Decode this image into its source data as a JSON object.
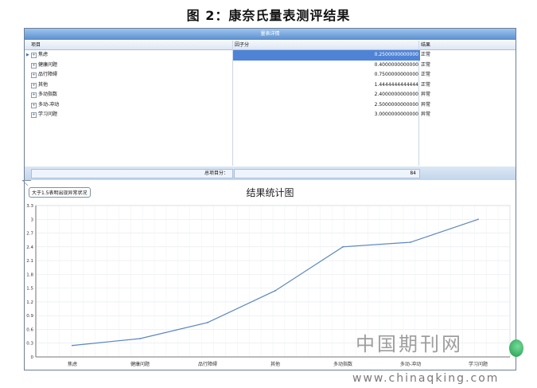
{
  "caption": "图 2：康奈氏量表测评结果",
  "panel": {
    "title": "量表详情",
    "columns": [
      "项目",
      "因子分",
      "结果"
    ],
    "rows": [
      {
        "name": "焦虑",
        "value": "0.2500000000000",
        "result": "正常"
      },
      {
        "name": "健康问题",
        "value": "0.4000000000000",
        "result": "正常"
      },
      {
        "name": "品行障碍",
        "value": "0.7500000000000",
        "result": "正常"
      },
      {
        "name": "其他",
        "value": "1.4444444444444",
        "result": "正常"
      },
      {
        "name": "多动指数",
        "value": "2.4000000000000",
        "result": "异常"
      },
      {
        "name": "多动-冲动",
        "value": "2.5000000000000",
        "result": "异常"
      },
      {
        "name": "学习问题",
        "value": "3.0000000000000",
        "result": "异常"
      }
    ],
    "footer_label": "总项目分：",
    "footer_total": "84"
  },
  "chart_note": "大于1.5表明出现异常状况",
  "chart_data": {
    "type": "line",
    "title": "结果统计图",
    "categories": [
      "焦虑",
      "健康问题",
      "品行障碍",
      "其他",
      "多动指数",
      "多动-冲动",
      "学习问题"
    ],
    "values": [
      0.25,
      0.4,
      0.75,
      1.4444,
      2.4,
      2.5,
      3.0
    ],
    "ylim": [
      0,
      3.3
    ],
    "yticks": [
      "0",
      "0.3",
      "0.6",
      "0.9",
      "1.2",
      "1.5",
      "1.8",
      "2.1",
      "2.4",
      "2.7",
      "3",
      "3.3"
    ],
    "grid": true,
    "line_color": "#5b86c0"
  },
  "watermark": {
    "cn": "中国期刊网",
    "url": "www.chinaqking.com"
  }
}
